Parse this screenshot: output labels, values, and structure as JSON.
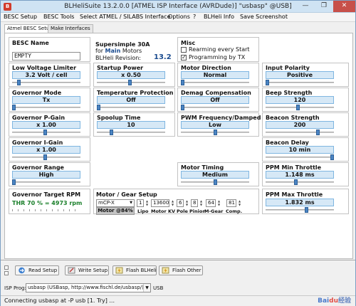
{
  "window": {
    "title": "BLHeliSuite 13.2.0.0  [ATMEL ISP Interface (AVRDude)] \"usbasp\" @USB]",
    "minimize": "—",
    "maximize": "❐",
    "close": "✕"
  },
  "menu": [
    "BESC Setup",
    "BESC Tools",
    "Select ATMEL / SILABS Interface",
    "Options",
    "?",
    "BLHeli Info",
    "Save Screenshot"
  ],
  "tabs": [
    "Atmel BESC Setup",
    "Make Interfaces"
  ],
  "besc": {
    "name_label": "BESC Name",
    "name_value": "EMPTY",
    "firmware_line1": "Supersimple 30A",
    "for_text": "for",
    "main_text": "Main",
    "motors_text": "Motors",
    "revision_label": "BLHeli Revision:",
    "revision_value": "13.2"
  },
  "misc": {
    "label": "Misc",
    "rearming": {
      "label": "Rearming every Start",
      "checked": false,
      "mark": ""
    },
    "programming_tx": {
      "label": "Programming by TX",
      "checked": true,
      "mark": "✓"
    }
  },
  "params": {
    "low_voltage": {
      "label": "Low Voltage Limiter",
      "value": "3.2 Volt / cell",
      "position": 0.08
    },
    "startup_power": {
      "label": "Startup Power",
      "value": "x 0.50",
      "position": 0.48
    },
    "motor_direction": {
      "label": "Motor Direction",
      "value": "Normal",
      "position": 0.0
    },
    "input_polarity": {
      "label": "Input Polarity",
      "value": "Positive",
      "position": 0.0
    },
    "governor_mode": {
      "label": "Governor Mode",
      "value": "Tx",
      "position": 0.0
    },
    "temperature_protection": {
      "label": "Temperature Protection",
      "value": "Off",
      "position": 0.0
    },
    "demag_compensation": {
      "label": "Demag Compensation",
      "value": "Off",
      "position": 0.0
    },
    "beep_strength": {
      "label": "Beep Strength",
      "value": "120",
      "position": 0.47
    },
    "governor_p_gain": {
      "label": "Governor P-Gain",
      "value": "x 1.00",
      "position": 0.48
    },
    "spoolup_time": {
      "label": "Spoolup Time",
      "value": "10",
      "position": 0.2
    },
    "pwm_frequency": {
      "label": "PWM Frequency/Damped",
      "value": "Low",
      "position": 0.5
    },
    "beacon_strength": {
      "label": "Beacon Strength",
      "value": "200",
      "position": 0.78
    },
    "governor_i_gain": {
      "label": "Governor I-Gain",
      "value": "x 1.00",
      "position": 0.48
    },
    "beacon_delay": {
      "label": "Beacon Delay",
      "value": "10 min",
      "position": 1.0
    },
    "governor_range": {
      "label": "Governor Range",
      "value": "High",
      "position": 0.0
    },
    "motor_timing": {
      "label": "Motor Timing",
      "value": "Medium",
      "position": 0.5
    },
    "ppm_min_throttle": {
      "label": "PPM Min Throttle",
      "value": "1.148 ms",
      "position": 0.44
    },
    "ppm_max_throttle": {
      "label": "PPM Max Throttle",
      "value": "1.832 ms",
      "position": 0.6
    }
  },
  "governor_target": {
    "label": "Governor Target RPM",
    "value": "THR 70 % = 4973 rpm"
  },
  "motor_gear": {
    "label": "Motor / Gear Setup",
    "motor_type": "mCP-X",
    "lipo": "1",
    "motor_kv": "13600",
    "pole": "6",
    "pinion": "8",
    "m_gear": "64",
    "comp": "81",
    "lipo_label": "Lipo",
    "motor_kv_label": "Motor KV",
    "pole_label": "Pole",
    "pinion_label": "Pinion",
    "m_gear_label": "M-Gear",
    "comp_label": "Comp.",
    "motor_pct": "Motor @84%",
    "dropdown_arrow": "▼"
  },
  "buttons": {
    "read_setup": "Read Setup",
    "write_setup": "Write Setup",
    "flash_blheli": "Flash BLHeli",
    "flash_other": "Flash Other"
  },
  "isp": {
    "label": "ISP Prog:",
    "value": "usbasp (USBasp, http://www.fischl.de/usbasp/)",
    "usb_label": "USB",
    "dropdown_arrow": "▼"
  },
  "status": {
    "text": "Connecting usbasp at -P usb [1. Try] ..."
  },
  "watermark": {
    "part1": "Bai",
    "part2": "du",
    "part3": "经验"
  },
  "colors": {
    "value_box": "#d6e8f6",
    "value_border": "#7fb6e1",
    "slider_thumb": "#4b84c2",
    "revision": "#1a4b8f",
    "governor_green": "#1a7f2a",
    "close_button": "#c7504a"
  }
}
